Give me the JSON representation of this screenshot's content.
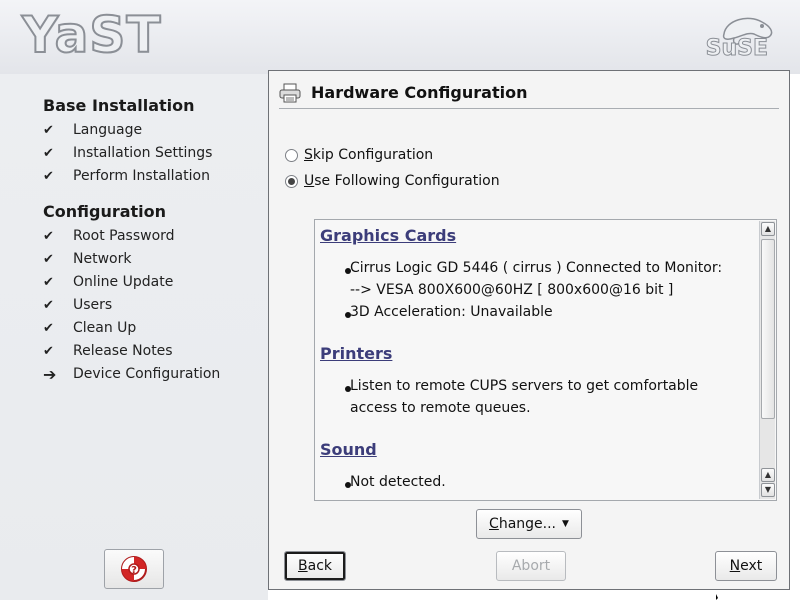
{
  "banner": {
    "app_logo_text": "YaST",
    "vendor_logo_text": "SuSE"
  },
  "sidebar": {
    "sections": [
      {
        "title": "Base Installation",
        "items": [
          {
            "label": "Language",
            "status": "done"
          },
          {
            "label": "Installation Settings",
            "status": "done"
          },
          {
            "label": "Perform Installation",
            "status": "done"
          }
        ]
      },
      {
        "title": "Configuration",
        "items": [
          {
            "label": "Root Password",
            "status": "done"
          },
          {
            "label": "Network",
            "status": "done"
          },
          {
            "label": "Online Update",
            "status": "done"
          },
          {
            "label": "Users",
            "status": "done"
          },
          {
            "label": "Clean Up",
            "status": "done"
          },
          {
            "label": "Release Notes",
            "status": "done"
          },
          {
            "label": "Device Configuration",
            "status": "current"
          }
        ]
      }
    ],
    "done_mark": "✔",
    "current_mark": "➔",
    "help_icon": "lifebuoy-icon"
  },
  "panel": {
    "title": "Hardware Configuration",
    "title_icon": "printer-icon",
    "options": [
      {
        "first": "S",
        "rest": "kip Configuration",
        "checked": false
      },
      {
        "first": "U",
        "rest": "se Following Configuration",
        "checked": true
      }
    ],
    "sections": [
      {
        "heading": "Graphics Cards",
        "bullets": [
          [
            "Cirrus Logic GD 5446 ( cirrus ) Connected to Monitor:",
            "--> VESA 800X600@60HZ [ 800x600@16 bit ]"
          ],
          [
            "3D Acceleration: Unavailable"
          ]
        ]
      },
      {
        "heading": "Printers",
        "bullets": [
          [
            "Listen to remote CUPS servers to get comfortable",
            "access to remote queues."
          ]
        ]
      },
      {
        "heading": "Sound",
        "bullets": [
          [
            "Not detected."
          ]
        ]
      }
    ],
    "change_button": {
      "first": "C",
      "rest": "hange..."
    },
    "back_button": {
      "first": "B",
      "rest": "ack"
    },
    "abort_button": {
      "first": "",
      "rest": "Abort"
    },
    "next_button": {
      "first": "N",
      "rest": "ext"
    }
  },
  "colors": {
    "heading_link": "#3c3d7a",
    "panel_bg": "#f4f4f4",
    "sidebar_bg": "#eceef1"
  }
}
